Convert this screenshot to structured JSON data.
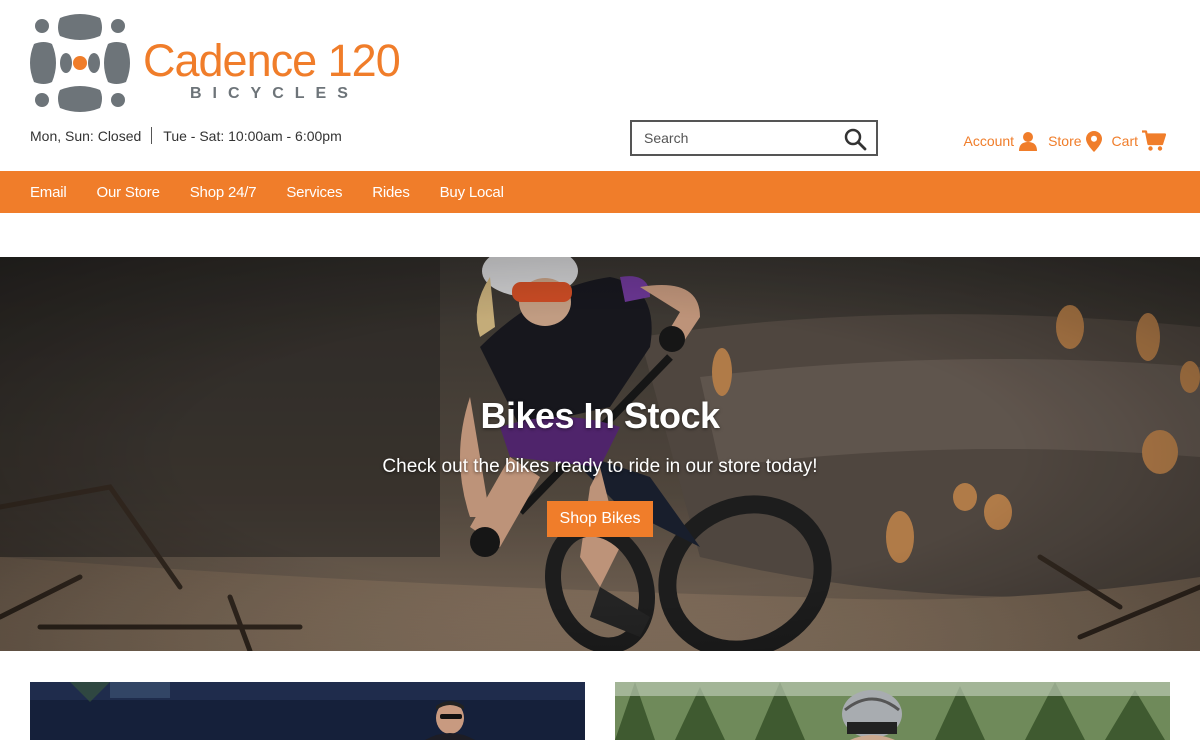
{
  "brand": {
    "name": "Cadence 120",
    "subtitle": "BICYCLES",
    "accent_color": "#f07d2a",
    "gray_color": "#6d7479"
  },
  "header": {
    "hours_closed": "Mon, Sun: Closed",
    "hours_open": "Tue - Sat: 10:00am - 6:00pm"
  },
  "search": {
    "placeholder": "Search",
    "icon": "search-icon"
  },
  "utility": [
    {
      "label": "Account",
      "icon": "user-icon"
    },
    {
      "label": "Store",
      "icon": "map-pin-icon"
    },
    {
      "label": "Cart",
      "icon": "cart-icon"
    }
  ],
  "nav": {
    "items": [
      "Email",
      "Our Store",
      "Shop 24/7",
      "Services",
      "Rides",
      "Buy Local"
    ]
  },
  "hero": {
    "title": "Bikes In Stock",
    "subtitle": "Check out the bikes ready to ride in our store today!",
    "button": "Shop Bikes"
  }
}
